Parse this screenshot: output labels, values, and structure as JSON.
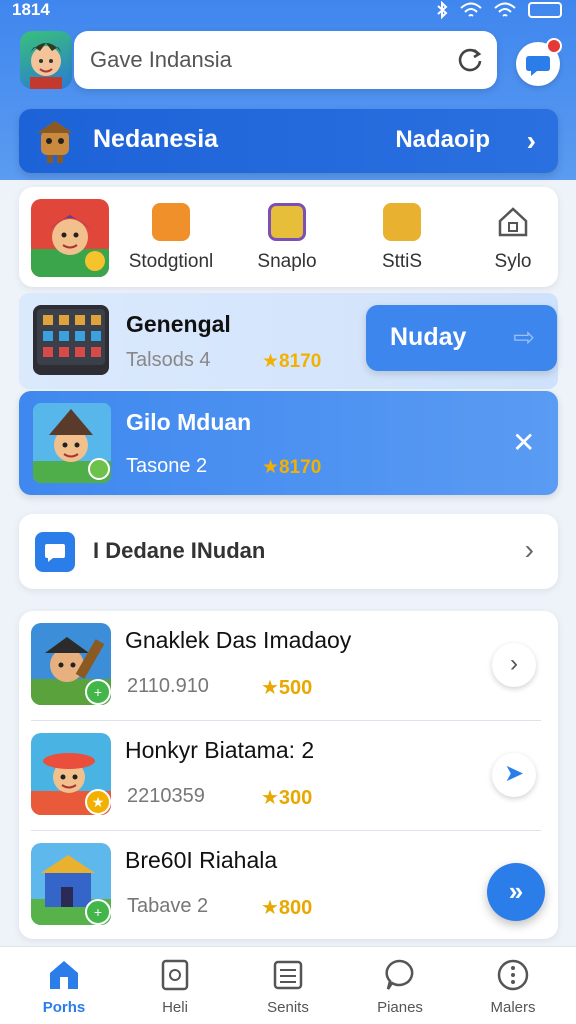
{
  "status_bar": {
    "time": "1814"
  },
  "search": {
    "value": "Gave Indansia"
  },
  "banner": {
    "title": "Nedanesia",
    "action": "Nadaoip"
  },
  "categories": [
    {
      "label": "Stodgtionl"
    },
    {
      "label": "Snaplo"
    },
    {
      "label": "SttiS"
    },
    {
      "label": "Sylo"
    }
  ],
  "featured": [
    {
      "name": "Genengal",
      "meta": "Talsods 4",
      "rating": "★8170"
    },
    {
      "name": "Gilo Mduan",
      "meta": "Tasone 2",
      "rating": "★8170"
    }
  ],
  "nudge_button": {
    "label": "Nuday"
  },
  "search_row": {
    "label": "I Dedane INudan"
  },
  "game_list": [
    {
      "name": "Gnaklek Das Imadaoy",
      "number": "2110.910",
      "rating": "★500"
    },
    {
      "name": "Honkyr Biatama: 2",
      "number": "2210359",
      "rating": "★300"
    },
    {
      "name": "Bre60I Riahala",
      "number": "Tabave 2",
      "rating": "★800"
    }
  ],
  "nav": [
    {
      "label": "Porhs"
    },
    {
      "label": "Heli"
    },
    {
      "label": "Senits"
    },
    {
      "label": "Pianes"
    },
    {
      "label": "Malers"
    }
  ],
  "colors": {
    "accent": "#2b7de9",
    "banner": "#1d63d8",
    "star": "#f2b100",
    "badge_green": "#43b649",
    "notification_red": "#e53935"
  },
  "icons": {
    "status": [
      "bluetooth-icon",
      "wifi-icon",
      "wifi-icon",
      "battery-icon"
    ],
    "search_action": "refresh-icon",
    "notify": "chat-icon",
    "categories": [
      "gift-icon",
      "book-icon",
      "grid-icon",
      "house-icon"
    ],
    "nav": [
      "home-icon",
      "document-icon",
      "list-icon",
      "speech-bubble-icon",
      "more-icon"
    ]
  }
}
